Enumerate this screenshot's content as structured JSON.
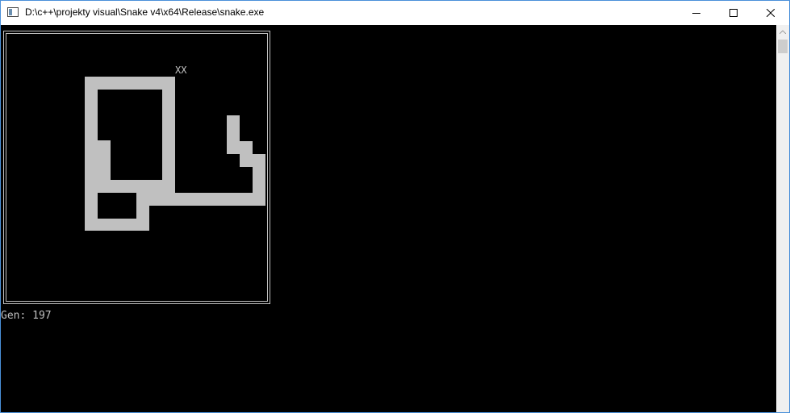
{
  "window": {
    "title": "D:\\c++\\projekty visual\\Snake v4\\x64\\Release\\snake.exe",
    "controls": [
      "minimize-icon",
      "maximize-icon",
      "close-icon"
    ]
  },
  "game": {
    "food_label": "XX",
    "status": {
      "gen_label": "Gen:",
      "gen_value": "197"
    },
    "colors": {
      "background": "#000000",
      "snake": "#c0c0c0",
      "border": "#c0c0c0",
      "text": "#c0c0c0"
    }
  }
}
